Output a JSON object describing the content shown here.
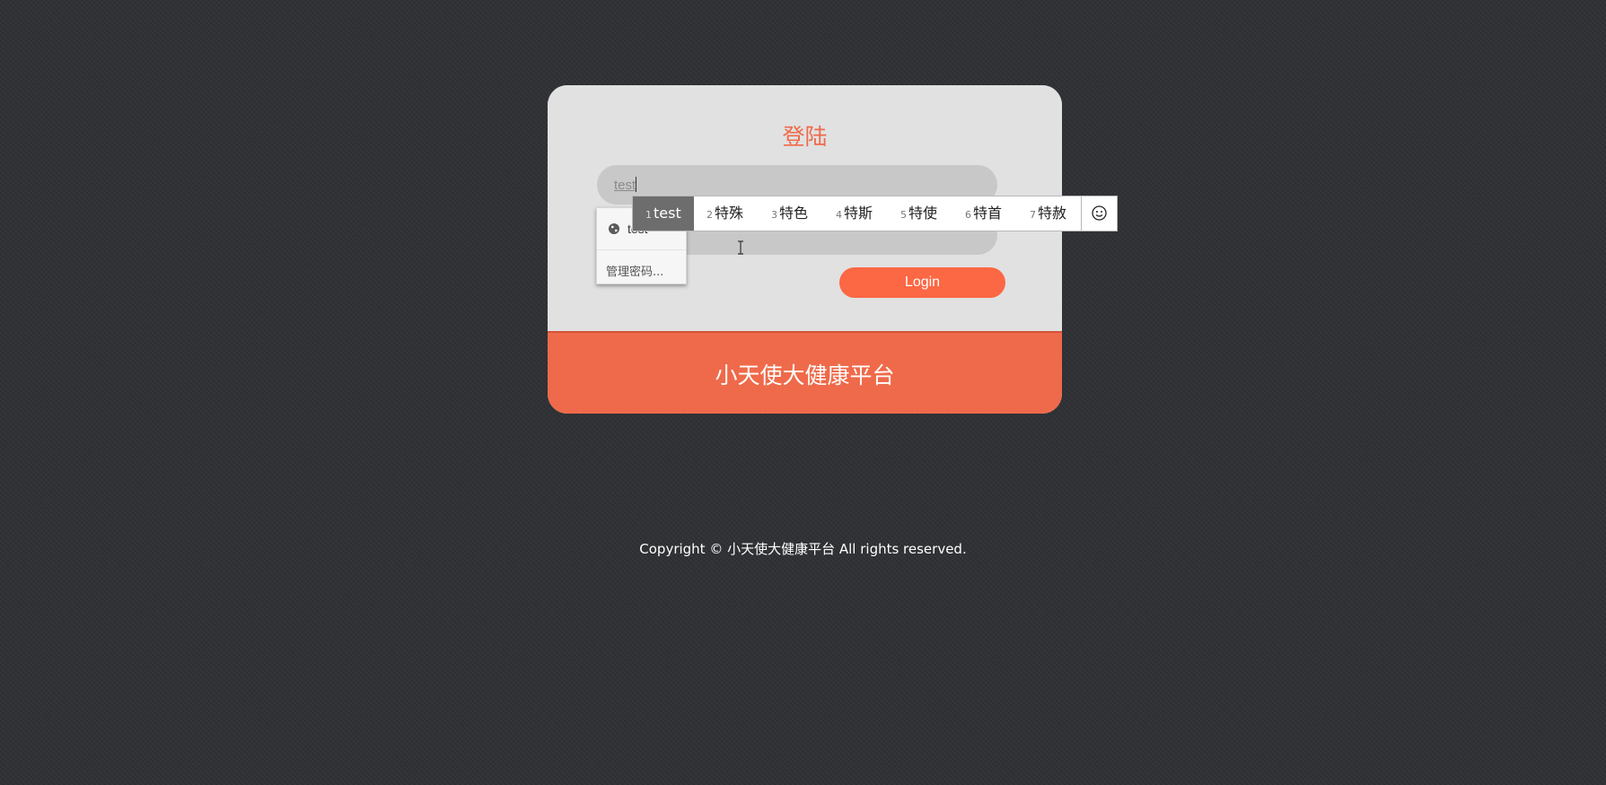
{
  "login_card": {
    "title": "登陆",
    "username_value": "test",
    "login_button": "Login",
    "platform_name": "小天使大健康平台"
  },
  "autofill": {
    "saved_user": "test",
    "manage_passwords": "管理密码..."
  },
  "ime": {
    "candidates": [
      {
        "num": "1",
        "text": "test"
      },
      {
        "num": "2",
        "text": "特殊"
      },
      {
        "num": "3",
        "text": "特色"
      },
      {
        "num": "4",
        "text": "特斯"
      },
      {
        "num": "5",
        "text": "特使"
      },
      {
        "num": "6",
        "text": "特首"
      },
      {
        "num": "7",
        "text": "特赦"
      }
    ],
    "emoji_icon": "smiley-icon"
  },
  "footer": {
    "copyright": "Copyright © 小天使大健康平台 All rights reserved."
  },
  "colors": {
    "accent": "#ef6a4a",
    "button": "#fc6744",
    "background": "#2e3033",
    "card": "#e1e1e1"
  }
}
